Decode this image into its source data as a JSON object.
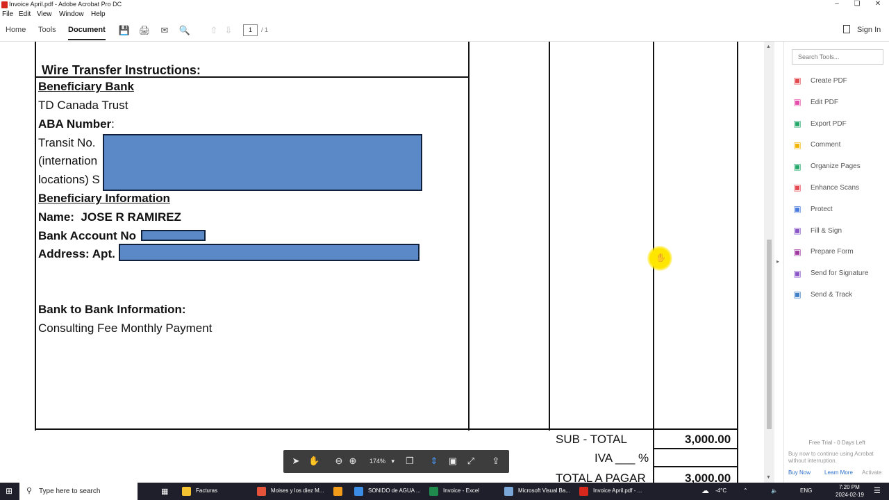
{
  "window": {
    "title": "Invoice April.pdf - Adobe Acrobat Pro DC"
  },
  "menu": [
    "File",
    "Edit",
    "View",
    "Window",
    "Help"
  ],
  "toolbar": {
    "tabs": [
      "Home",
      "Tools",
      "Document"
    ],
    "active_tab": "Document",
    "page_current": "1",
    "page_total": "/ 1",
    "sign_in": "Sign In"
  },
  "document": {
    "wire_title": "Wire Transfer Instructions:",
    "beneficiary_bank_label": "Beneficiary Bank",
    "bank_name": "TD Canada Trust",
    "aba_label": "ABA Number",
    "aba_colon": ":",
    "transit": "Transit No.",
    "international": "(internation",
    "locations": "locations) S",
    "beneficiary_info_label": "Beneficiary Information",
    "name_label": "Name:",
    "name_value": "JOSE R RAMIREZ",
    "account_label": "Bank Account No",
    "address_label": "Address",
    "address_value": ": Apt.",
    "b2b_label": "Bank to Bank Information",
    "b2b_colon": ":",
    "b2b_value": "Consulting Fee Monthly Payment",
    "subtotal_label": "SUB - TOTAL",
    "subtotal_value": "3,000.00",
    "iva_label": "IVA ___ %",
    "total_label": "TOTAL A PAGAR",
    "total_value": "3,000.00"
  },
  "tools_pane": {
    "search_placeholder": "Search Tools...",
    "items": [
      {
        "label": "Create PDF",
        "icon": "create-pdf-icon",
        "color": "#e34850"
      },
      {
        "label": "Edit PDF",
        "icon": "edit-pdf-icon",
        "color": "#e34cab"
      },
      {
        "label": "Export PDF",
        "icon": "export-pdf-icon",
        "color": "#27a86b"
      },
      {
        "label": "Comment",
        "icon": "comment-icon",
        "color": "#f2b400"
      },
      {
        "label": "Organize Pages",
        "icon": "organize-pages-icon",
        "color": "#27a86b"
      },
      {
        "label": "Enhance Scans",
        "icon": "enhance-scans-icon",
        "color": "#e34850"
      },
      {
        "label": "Protect",
        "icon": "protect-icon",
        "color": "#4a7bde"
      },
      {
        "label": "Fill & Sign",
        "icon": "fill-sign-icon",
        "color": "#8a56c6"
      },
      {
        "label": "Prepare Form",
        "icon": "prepare-form-icon",
        "color": "#a03ca0"
      },
      {
        "label": "Send for Signature",
        "icon": "send-signature-icon",
        "color": "#8a56c6"
      },
      {
        "label": "Send & Track",
        "icon": "send-track-icon",
        "color": "#3f80c6"
      }
    ],
    "trial_title": "Free Trial - 0 Days Left",
    "trial_text": "Buy now to continue using Acrobat without interruption.",
    "buy_now": "Buy Now",
    "learn_more": "Learn More",
    "activate": "Activate"
  },
  "floating_toolbar": {
    "zoom": "174%"
  },
  "taskbar": {
    "search": "Type here to search",
    "apps": [
      {
        "label": "Facturas",
        "color": "#f3c332"
      },
      {
        "label": "Moises y los diez M...",
        "color": "#e5533b"
      },
      {
        "label": "",
        "color": "#f39c1a"
      },
      {
        "label": "SONIDO de AGUA ...",
        "color": "#3c8de6"
      },
      {
        "label": "Invoice - Excel",
        "color": "#1f8a4c"
      },
      {
        "label": "Microsoft Visual Ba...",
        "color": "#7aa7d8"
      },
      {
        "label": "Invoice April.pdf - ...",
        "color": "#d7281e"
      }
    ],
    "weather": "-4°C",
    "language": "ENG",
    "time": "7:20 PM",
    "date": "2024-02-19"
  }
}
